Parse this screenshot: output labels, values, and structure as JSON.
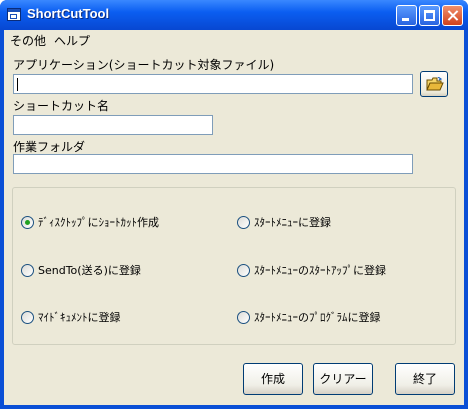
{
  "window": {
    "title": "ShortCutTool"
  },
  "menu": {
    "items": [
      "その他",
      "ヘルプ"
    ]
  },
  "form": {
    "app_label": "アプリケーション(ショートカット対象ファイル)",
    "app_value": "",
    "shortcut_label": "ショートカット名",
    "shortcut_value": "",
    "workdir_label": "作業フォルダ",
    "workdir_value": ""
  },
  "options": [
    {
      "label": "ﾃﾞｨｽｸﾄｯﾌﾟにｼｮｰﾄｶｯﾄ作成",
      "checked": true
    },
    {
      "label": "ｽﾀｰﾄﾒﾆｭｰに登録",
      "checked": false
    },
    {
      "label": "SendTo(送る)に登録",
      "checked": false
    },
    {
      "label": "ｽﾀｰﾄﾒﾆｭｰのｽﾀｰﾄｱｯﾌﾟに登録",
      "checked": false
    },
    {
      "label": "ﾏｲﾄﾞｷｭﾒﾝﾄに登録",
      "checked": false
    },
    {
      "label": "ｽﾀｰﾄﾒﾆｭｰのﾌﾟﾛｸﾞﾗﾑに登録",
      "checked": false
    }
  ],
  "buttons": {
    "create": "作成",
    "clear": "クリアー",
    "exit": "終了"
  },
  "icons": {
    "browse": "folder-open-icon"
  }
}
